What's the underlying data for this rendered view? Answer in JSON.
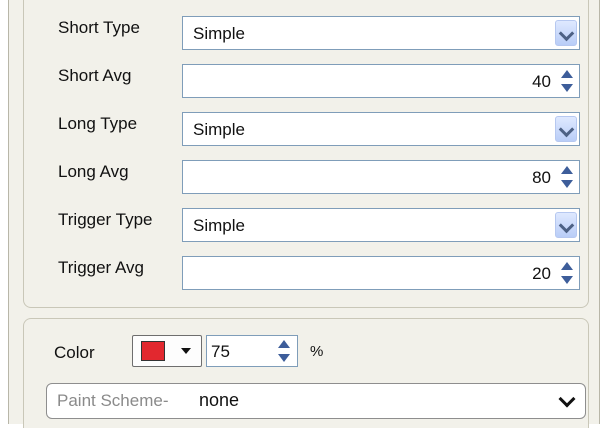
{
  "params": {
    "rows": [
      {
        "label": "Short Type",
        "kind": "dropdown",
        "value": "Simple"
      },
      {
        "label": "Short Avg",
        "kind": "spinner",
        "value": "40"
      },
      {
        "label": "Long Type",
        "kind": "dropdown",
        "value": "Simple"
      },
      {
        "label": "Long Avg",
        "kind": "spinner",
        "value": "80"
      },
      {
        "label": "Trigger Type",
        "kind": "dropdown",
        "value": "Simple"
      },
      {
        "label": "Trigger Avg",
        "kind": "spinner",
        "value": "20"
      }
    ]
  },
  "appearance": {
    "color_label": "Color",
    "color_value": "#e2282f",
    "opacity_value": "75",
    "percent_label": "%",
    "paint_scheme_prefix": "Paint Scheme-",
    "paint_scheme_value": "none"
  },
  "colors": {
    "panel_bg": "#f2f1ea",
    "field_border": "#7f9db9",
    "dropdown_button": "#b9cdf7",
    "spinner_arrow": "#3d5d9a"
  }
}
